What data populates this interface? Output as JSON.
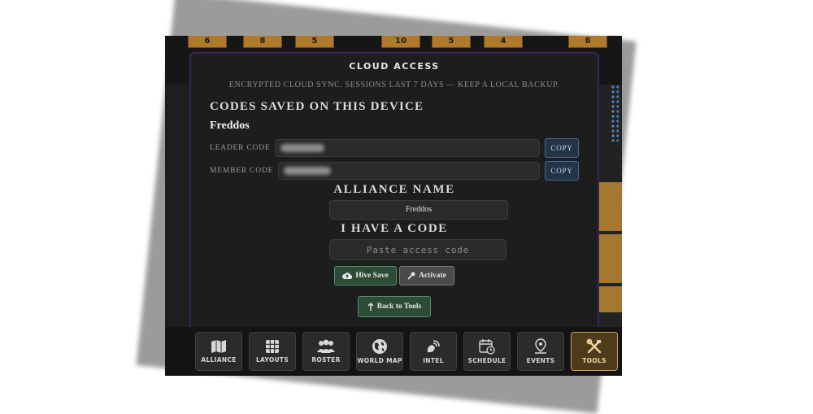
{
  "modal": {
    "title": "CLOUD ACCESS",
    "subtitle": "ENCRYPTED CLOUD SYNC. SESSIONS LAST 7 DAYS — KEEP A LOCAL BACKUP.",
    "codes_heading": "CODES SAVED ON THIS DEVICE",
    "device_name": "Freddos",
    "leader_code_label": "LEADER CODE",
    "member_code_label": "MEMBER CODE",
    "copy_label": "COPY",
    "alliance_name_heading": "ALLIANCE NAME",
    "alliance_name_value": "Freddos",
    "have_code_heading": "I HAVE A CODE",
    "code_placeholder": "Paste access code",
    "hive_save_label": "Hive Save",
    "activate_label": "Activate",
    "back_label": "Back to Tools"
  },
  "board": {
    "top_tiles": [
      "6",
      "8",
      "5",
      "10",
      "5",
      "4",
      "8"
    ]
  },
  "tabs": [
    {
      "label": "ALLIANCE",
      "icon": "map-icon"
    },
    {
      "label": "LAYOUTS",
      "icon": "grid-icon"
    },
    {
      "label": "ROSTER",
      "icon": "users-icon"
    },
    {
      "label": "WORLD MAP",
      "icon": "globe-icon"
    },
    {
      "label": "INTEL",
      "icon": "satellite-icon"
    },
    {
      "label": "SCHEDULE",
      "icon": "calendar-icon"
    },
    {
      "label": "EVENTS",
      "icon": "location-pin-icon"
    },
    {
      "label": "TOOLS",
      "icon": "tools-icon",
      "active": true
    }
  ],
  "colors": {
    "accent_gold": "#c7a054",
    "button_green": "#2c4c37",
    "copy_blue": "#243447"
  }
}
